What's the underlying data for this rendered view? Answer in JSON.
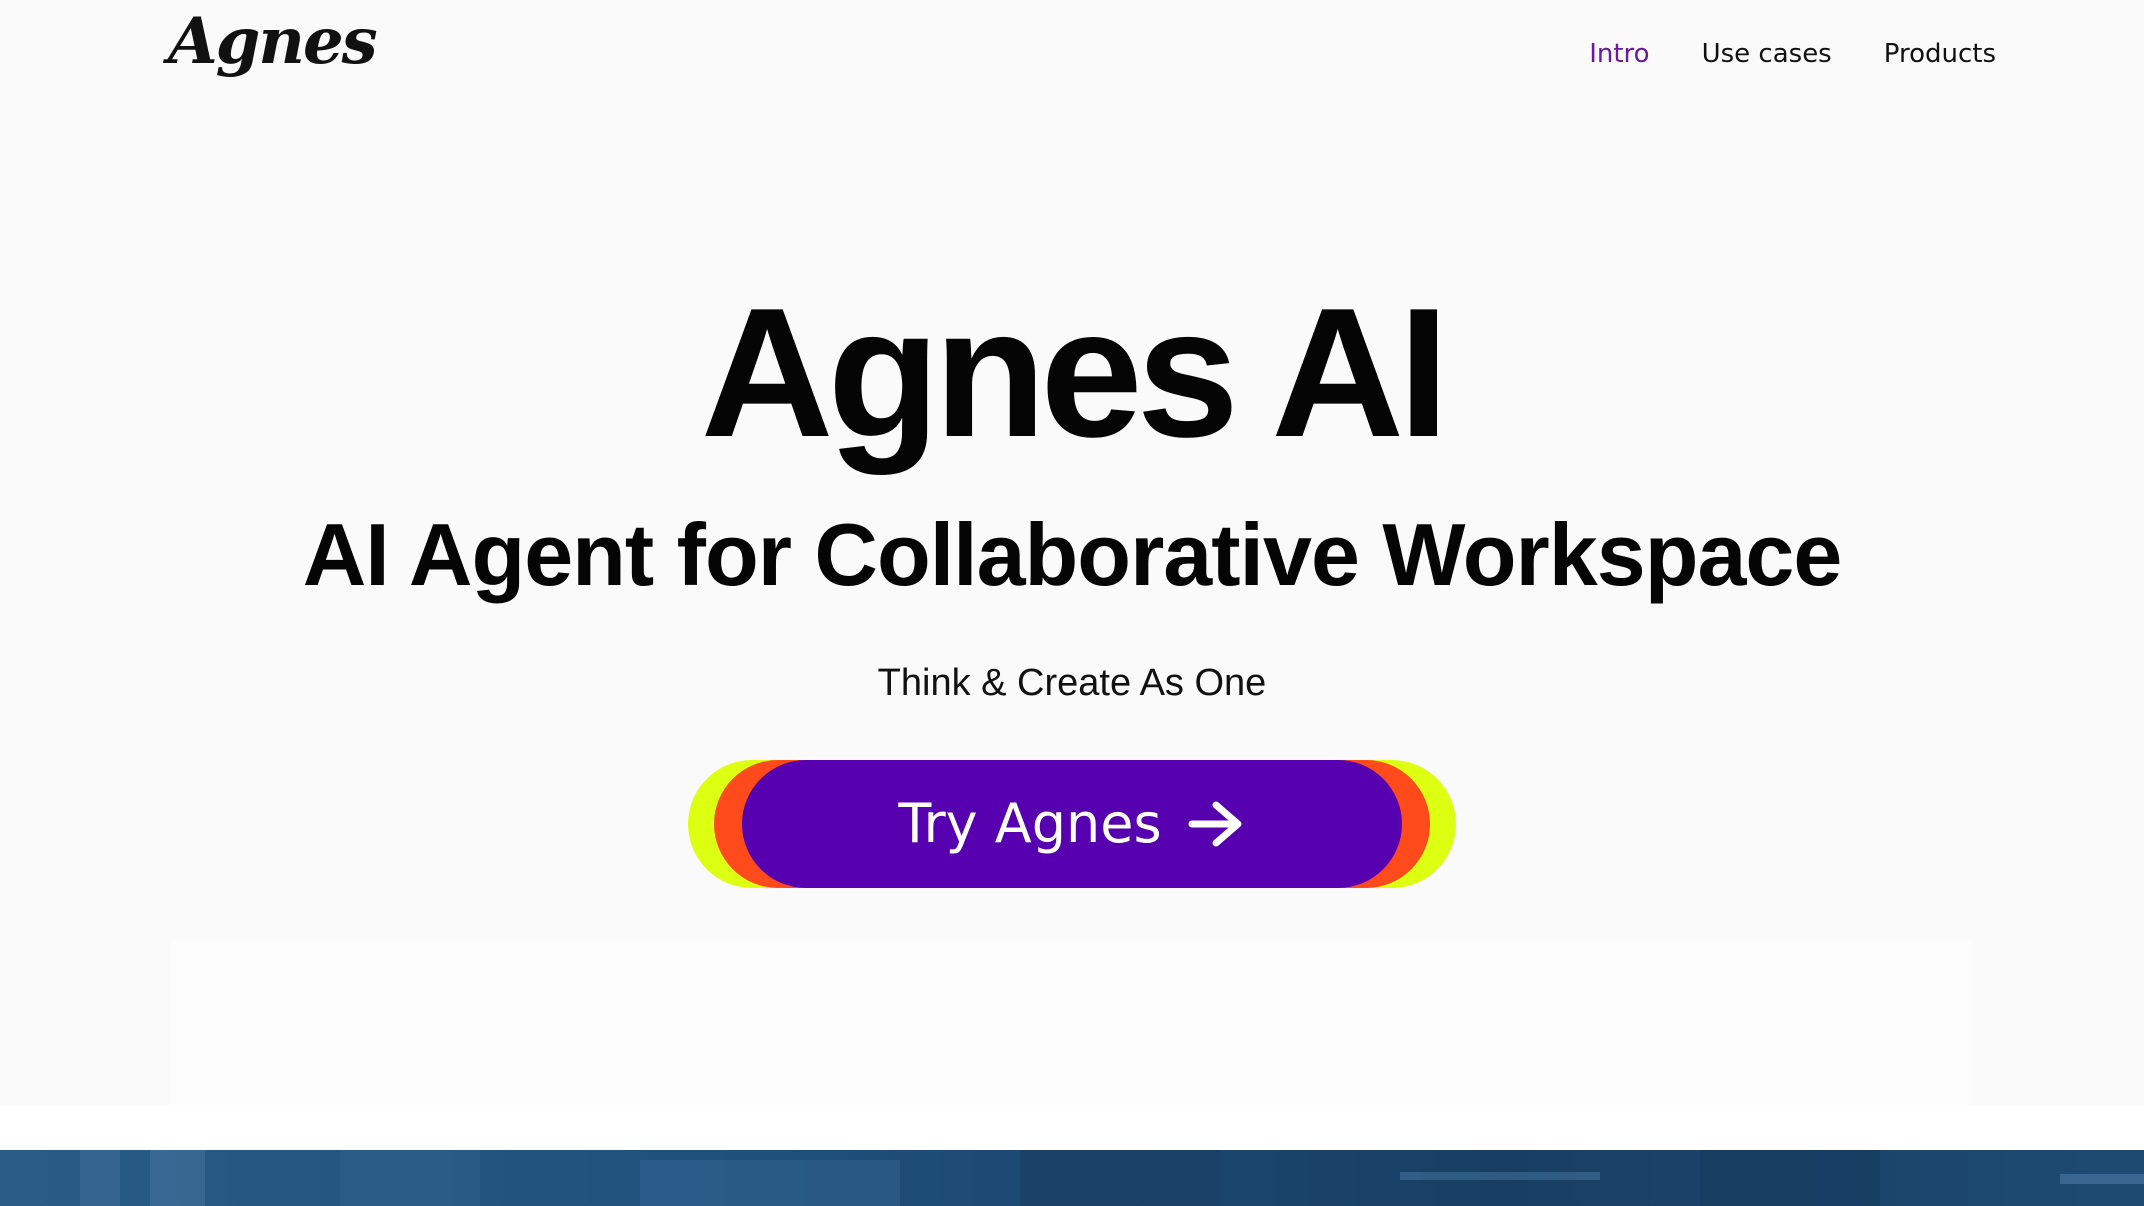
{
  "header": {
    "logo_text": "Agnes",
    "nav": [
      {
        "label": "Intro",
        "active": true
      },
      {
        "label": "Use cases",
        "active": false
      },
      {
        "label": "Products",
        "active": false
      }
    ]
  },
  "hero": {
    "title": "Agnes AI",
    "subtitle": "AI Agent for Collaborative Workspace",
    "tagline": "Think & Create As One",
    "cta_label": "Try Agnes",
    "cta_icon": "arrow-right-icon"
  },
  "colors": {
    "accent_nav": "#6a1b9a",
    "cta_primary": "#5600b0",
    "cta_ring_orange": "#ff4a1c",
    "cta_ring_yellow": "#dcff12",
    "strip_blue": "#1e4c78"
  }
}
